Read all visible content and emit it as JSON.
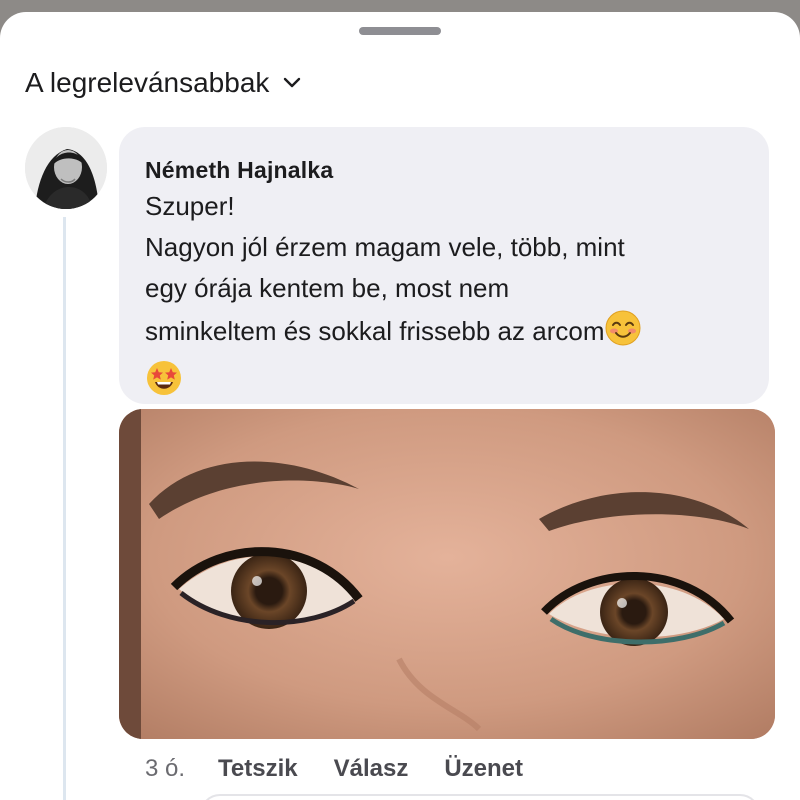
{
  "sort": {
    "label": "A legrelevánsabbak"
  },
  "comment": {
    "author": "Németh Hajnalka",
    "lines": [
      "Szuper!",
      "Nagyon jól érzem magam vele, több, mint",
      "egy órája kentem be, most nem",
      "sminkeltem és sokkal frissebb az arcom"
    ],
    "emojis": [
      "smiling-face-emoji",
      "star-struck-emoji"
    ],
    "photo": "close-up-eyes-photo",
    "time": "3 ó.",
    "actions": {
      "like": "Tetszik",
      "reply": "Válasz",
      "message": "Üzenet"
    }
  }
}
